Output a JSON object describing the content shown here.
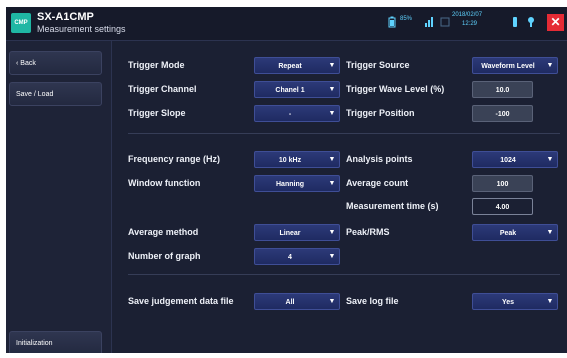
{
  "header": {
    "logo_text": "CMP",
    "app_name": "SX-A1CMP",
    "subtitle": "Measurement settings",
    "battery_percent": "85%",
    "date": "2018/02/07",
    "time": "12:29"
  },
  "sidebar": {
    "back_label": "Back",
    "save_load_label": "Save / Load",
    "initialization_label": "Initialization"
  },
  "trigger": {
    "mode_label": "Trigger Mode",
    "mode_value": "Repeat",
    "channel_label": "Trigger Channel",
    "channel_value": "Chanel 1",
    "slope_label": "Trigger Slope",
    "slope_value": "-",
    "source_label": "Trigger Source",
    "source_value": "Waveform Level",
    "wave_level_label": "Trigger Wave Level (%)",
    "wave_level_value": "10.0",
    "position_label": "Trigger Position",
    "position_value": "-100"
  },
  "analysis": {
    "freq_label": "Frequency range (Hz)",
    "freq_value": "10 kHz",
    "window_label": "Window function",
    "window_value": "Hanning",
    "avg_method_label": "Average method",
    "avg_method_value": "Linear",
    "num_graph_label": "Number of graph",
    "num_graph_value": "4",
    "points_label": "Analysis points",
    "points_value": "1024",
    "avg_count_label": "Average count",
    "avg_count_value": "100",
    "meas_time_label": "Measurement time (s)",
    "meas_time_value": "4.00",
    "peak_rms_label": "Peak/RMS",
    "peak_rms_value": "Peak"
  },
  "saving": {
    "judge_label": "Save judgement data file",
    "judge_value": "All",
    "log_label": "Save log file",
    "log_value": "Yes"
  },
  "colors": {
    "accent": "#1fb7a4",
    "close": "#e52b35",
    "background": "#1b2033",
    "dropdown": "#2c3a78"
  }
}
